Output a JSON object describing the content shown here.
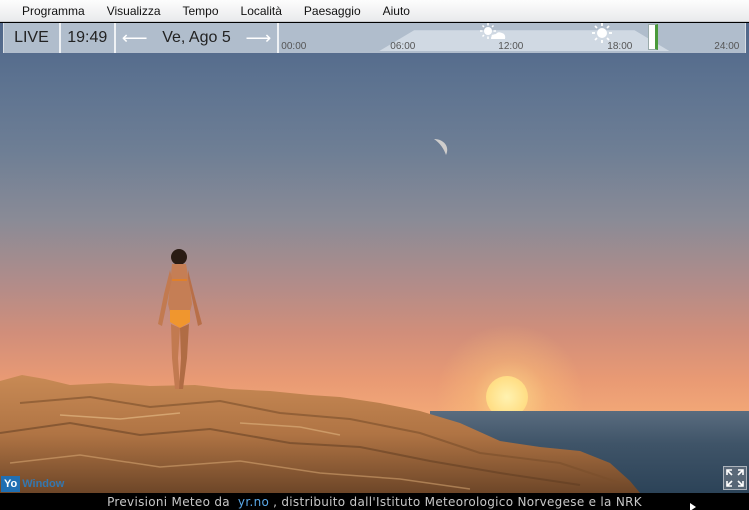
{
  "menu": {
    "items": [
      "Programma",
      "Visualizza",
      "Tempo",
      "Località",
      "Paesaggio",
      "Aiuto"
    ]
  },
  "toolbar": {
    "live_label": "LIVE",
    "time": "19:49",
    "date": "Ve, Ago 5",
    "prev_arrow": "⟵",
    "next_arrow": "⟶",
    "timeline_ticks": [
      "00:00",
      "06:00",
      "12:00",
      "18:00",
      "24:00"
    ]
  },
  "icons": {
    "noon": "partly-cloudy-icon",
    "evening": "sun-icon"
  },
  "logo": {
    "yo": "Yo",
    "rest": "Window"
  },
  "footer": {
    "prefix": "Previsioni Meteo da",
    "link": "yr.no",
    "suffix": ", distribuito dall'Istituto Meteorologico Norvegese e la NRK"
  },
  "colors": {
    "menubar": "#eceef0",
    "toolbar": "#b9c4d1",
    "link": "#5aa7e6"
  }
}
